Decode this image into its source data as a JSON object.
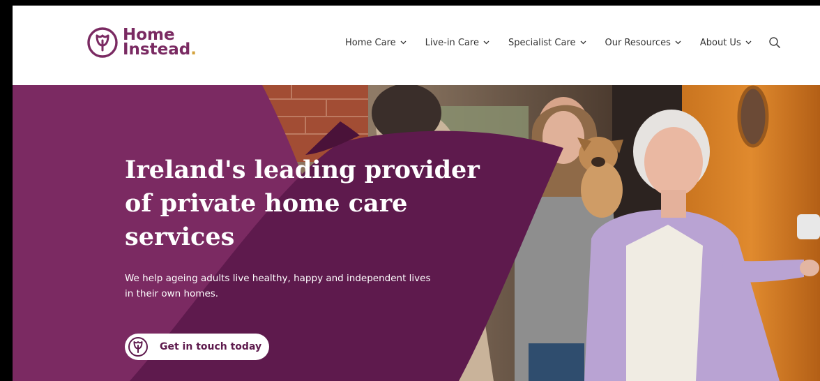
{
  "brand": {
    "line1": "Home",
    "line2": "Instead",
    "dot": ".",
    "icon": "tulip-logo-icon",
    "color": "#7a2a62",
    "accent": "#d3a23c"
  },
  "nav": {
    "items": [
      {
        "label": "Home Care"
      },
      {
        "label": "Live-in Care"
      },
      {
        "label": "Specialist Care"
      },
      {
        "label": "Our Resources"
      },
      {
        "label": "About Us"
      }
    ],
    "search_icon": "search-icon"
  },
  "hero": {
    "title": "Ireland's leading provider of private home care services",
    "subtitle": "We help ageing adults live healthy, happy and independent lives in their own homes.",
    "cta_label": "Get in touch today",
    "cta_icon": "tulip-logo-icon",
    "colors": {
      "plum_dark": "#5e1a4d",
      "plum_light": "#7b2a62"
    }
  }
}
